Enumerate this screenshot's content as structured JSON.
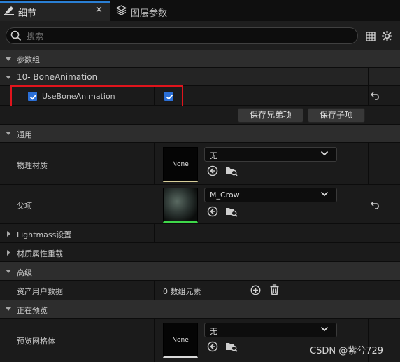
{
  "tabs": [
    {
      "label": "细节",
      "active": true
    },
    {
      "label": "图层参数",
      "active": false
    }
  ],
  "search": {
    "placeholder": "搜索"
  },
  "sections": {
    "param_group": "参数组",
    "bone_group": "10- BoneAnimation",
    "general": "通用",
    "lightmass": "Lightmass设置",
    "material_override": "材质属性重载",
    "advanced": "高级",
    "preview": "正在预览"
  },
  "bone_param": {
    "label": "UseBoneAnimation",
    "checked": true,
    "value_checked": true
  },
  "buttons": {
    "save_sibling": "保存兄弟项",
    "save_child": "保存子项"
  },
  "physical_material": {
    "label": "物理材质",
    "thumb": "None",
    "combo": "无"
  },
  "parent": {
    "label": "父项",
    "combo": "M_Crow"
  },
  "asset_user_data": {
    "label": "资产用户数据",
    "value": "0 数组元素"
  },
  "preview_mesh": {
    "label": "预览网格体",
    "thumb": "None",
    "combo": "无"
  },
  "watermark": "CSDN @紫兮729",
  "colors": {
    "accent": "#2b6fd6",
    "highlight": "#e0141c",
    "tab_accent": "#2a7fd4"
  }
}
